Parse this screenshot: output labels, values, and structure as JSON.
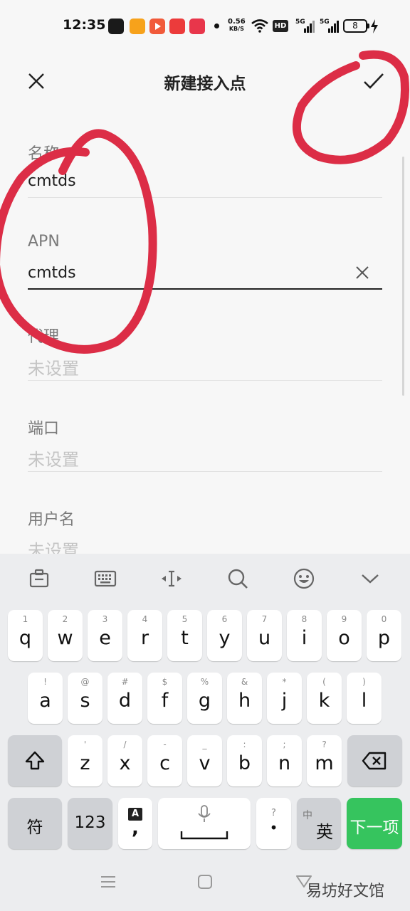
{
  "status_bar": {
    "time": "12:35",
    "net_speed_value": "0.56",
    "net_speed_unit": "KB/S",
    "hd_label": "HD",
    "signal_1_label": "5G",
    "signal_2_label": "5G",
    "battery": "8"
  },
  "header": {
    "title": "新建接入点",
    "close_icon": "close-icon",
    "confirm_icon": "checkmark-icon"
  },
  "form": {
    "name": {
      "label": "名称",
      "value": "cmtds"
    },
    "apn": {
      "label": "APN",
      "value": "cmtds"
    },
    "proxy": {
      "label": "代理",
      "placeholder": "未设置"
    },
    "port": {
      "label": "端口",
      "placeholder": "未设置"
    },
    "username": {
      "label": "用户名",
      "placeholder": "未设置"
    }
  },
  "keyboard": {
    "toolbar": [
      "clipboard-icon",
      "keyboard-icon",
      "cursor-move-icon",
      "search-icon",
      "emoji-icon",
      "collapse-chevron-icon"
    ],
    "row1": [
      {
        "main": "q",
        "hint": "1"
      },
      {
        "main": "w",
        "hint": "2"
      },
      {
        "main": "e",
        "hint": "3"
      },
      {
        "main": "r",
        "hint": "4"
      },
      {
        "main": "t",
        "hint": "5"
      },
      {
        "main": "y",
        "hint": "6"
      },
      {
        "main": "u",
        "hint": "7"
      },
      {
        "main": "i",
        "hint": "8"
      },
      {
        "main": "o",
        "hint": "9"
      },
      {
        "main": "p",
        "hint": "0"
      }
    ],
    "row2": [
      {
        "main": "a",
        "hint": "!"
      },
      {
        "main": "s",
        "hint": "@"
      },
      {
        "main": "d",
        "hint": "#"
      },
      {
        "main": "f",
        "hint": "$"
      },
      {
        "main": "g",
        "hint": "%"
      },
      {
        "main": "h",
        "hint": "&"
      },
      {
        "main": "j",
        "hint": "*"
      },
      {
        "main": "k",
        "hint": "("
      },
      {
        "main": "l",
        "hint": ")"
      }
    ],
    "row3": [
      {
        "main": "z",
        "hint": "'"
      },
      {
        "main": "x",
        "hint": "/"
      },
      {
        "main": "c",
        "hint": "-"
      },
      {
        "main": "v",
        "hint": "_"
      },
      {
        "main": "b",
        "hint": ":"
      },
      {
        "main": "n",
        "hint": ";"
      },
      {
        "main": "m",
        "hint": "?"
      }
    ],
    "shift_icon": "shift-arrow-icon",
    "backspace_icon": "backspace-icon",
    "symbol_key": "符",
    "number_key": "123",
    "punct_top": "A",
    "punct_bottom": ",",
    "voice_icon": "microphone-icon",
    "period_top": "?",
    "period_main": "•",
    "lang_small": "中",
    "lang_main": "英",
    "next_key": "下一项",
    "next_key_color": "#36c45e"
  },
  "nav": {
    "menu_icon": "menu-lines-icon",
    "home_icon": "home-square-icon",
    "back_icon": "back-triangle-icon"
  },
  "watermark": "易坊好文馆",
  "annotation_color": "#dc2d46"
}
